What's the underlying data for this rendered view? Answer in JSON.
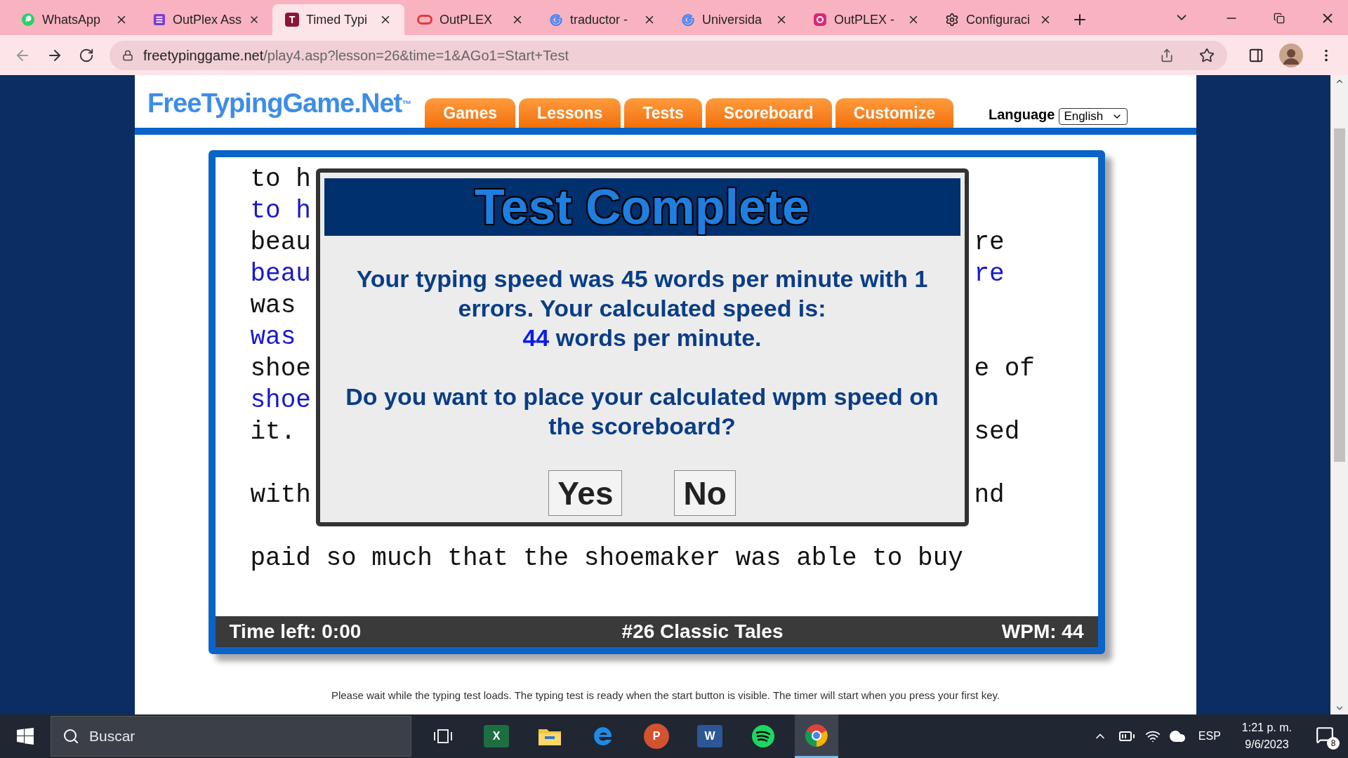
{
  "browser": {
    "tabs": [
      {
        "title": "WhatsApp",
        "kind": "whatsapp",
        "selected": false
      },
      {
        "title": "OutPlex Ass",
        "kind": "list",
        "selected": false
      },
      {
        "title": "Timed Typi",
        "kind": "letter",
        "letter": "T",
        "selected": true
      },
      {
        "title": "OutPLEX",
        "kind": "oval",
        "selected": false
      },
      {
        "title": "traductor -",
        "kind": "google",
        "selected": false
      },
      {
        "title": "Universida",
        "kind": "google",
        "selected": false
      },
      {
        "title": "OutPLEX -",
        "kind": "instagram",
        "selected": false
      },
      {
        "title": "Configuraci",
        "kind": "gear",
        "selected": false
      }
    ],
    "url_host": "freetypinggame.net",
    "url_path": "/play4.asp?lesson=26&time=1&AGo1=Start+Test"
  },
  "site": {
    "logo": "FreeTypingGame.Net",
    "logo_mark": "™",
    "nav": [
      "Games",
      "Lessons",
      "Tests",
      "Scoreboard",
      "Customize"
    ],
    "language_label": "Language",
    "language_value": "English"
  },
  "typing": {
    "paragraphs": [
      [
        {
          "left": "to h",
          "typed": false
        },
        {
          "left": "to h",
          "typed": true
        },
        {
          "left": "beau",
          "right": "re",
          "typed": false
        },
        {
          "left": "beau",
          "right": "re",
          "typed": true
        },
        {
          "left": "was",
          "typed": false
        },
        {
          "left": "was",
          "typed": true
        },
        {
          "left": "shoe",
          "right": "e of",
          "typed": false
        },
        {
          "left": "shoe",
          "typed": true
        },
        {
          "left": "it.",
          "right": "sed",
          "typed": false
        }
      ],
      [
        {
          "left": "with",
          "right": "nd",
          "typed": false
        }
      ],
      [
        {
          "left": "paid so much that the shoemaker was able to buy",
          "typed": false
        }
      ]
    ],
    "status": {
      "time_left": "Time left: 0:00",
      "lesson": "#26 Classic Tales",
      "wpm": "WPM: 44"
    }
  },
  "dialog": {
    "title": "Test Complete",
    "message": "Your typing speed was 45 words per minute with 1 errors. Your calculated speed is:",
    "calculated_wpm": "44",
    "wpm_suffix": "words per minute.",
    "question": "Do you want to place your calculated wpm speed on the scoreboard?",
    "buttons": [
      "Yes",
      "No"
    ]
  },
  "footer": "Please wait while the typing test loads. The typing test is ready when the start button is visible. The timer will start when you press your first key.",
  "taskbar": {
    "search_placeholder": "Buscar",
    "apps": [
      {
        "kind": "taskview",
        "active": false
      },
      {
        "kind": "excel",
        "letter": "X",
        "active": false
      },
      {
        "kind": "folder",
        "active": false
      },
      {
        "kind": "edge",
        "active": false
      },
      {
        "kind": "powerpoint",
        "letter": "P",
        "active": false
      },
      {
        "kind": "word",
        "letter": "W",
        "active": false
      },
      {
        "kind": "spotify",
        "active": false
      },
      {
        "kind": "chrome",
        "active": true
      }
    ],
    "language": "ESP",
    "time": "1:21 p. m.",
    "date": "9/6/2023",
    "notifications": "8"
  }
}
